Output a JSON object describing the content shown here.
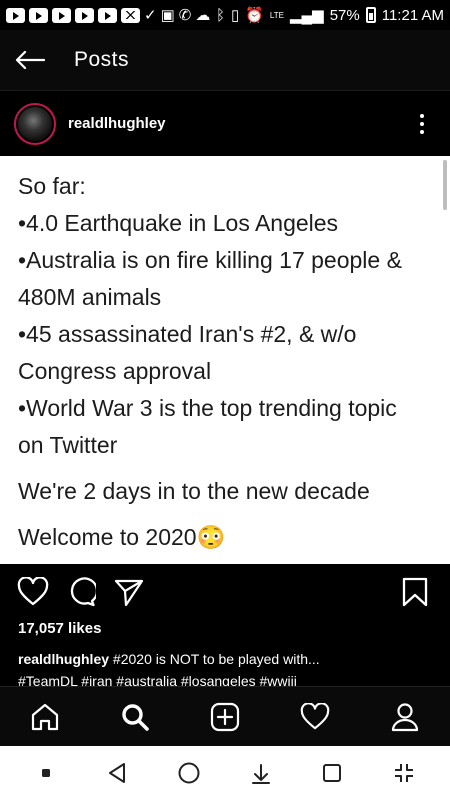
{
  "status_bar": {
    "battery": "57%",
    "time": "11:21 AM",
    "network": "LTE",
    "notification_icons": [
      "youtube-icon",
      "youtube-icon",
      "youtube-icon",
      "youtube-icon",
      "youtube-icon",
      "gmail-icon",
      "check-icon",
      "image-icon",
      "phone-icon",
      "weather-icon"
    ]
  },
  "header": {
    "title": "Posts"
  },
  "post": {
    "username": "realdlhughley",
    "avatar_ring_color": "#c0184e",
    "image_text": {
      "lines": [
        "So far:",
        "•4.0 Earthquake in Los Angeles",
        "•Australia is on fire killing 17 people &",
        "480M animals",
        "•45 assassinated Iran's #2, & w/o",
        "Congress approval",
        "•World War 3 is the top trending topic",
        "on Twitter"
      ],
      "line_decade": "We're 2 days in to the new decade",
      "line_welcome": "Welcome to 2020😳"
    },
    "likes": "17,057 likes",
    "caption": {
      "username": "realdlhughley",
      "text": " #2020 is NOT to be played with...",
      "hashtags": "#TeamDL #iran #australia #losangeles #wwiii"
    }
  },
  "bottom_nav": {
    "items": [
      "home-icon",
      "search-icon",
      "add-post-icon",
      "activity-heart-icon",
      "profile-icon"
    ]
  },
  "system_nav": {
    "items": [
      "dot-icon",
      "back-triangle-icon",
      "home-circle-icon",
      "down-arrow-icon",
      "recents-square-icon",
      "expand-icon"
    ]
  }
}
